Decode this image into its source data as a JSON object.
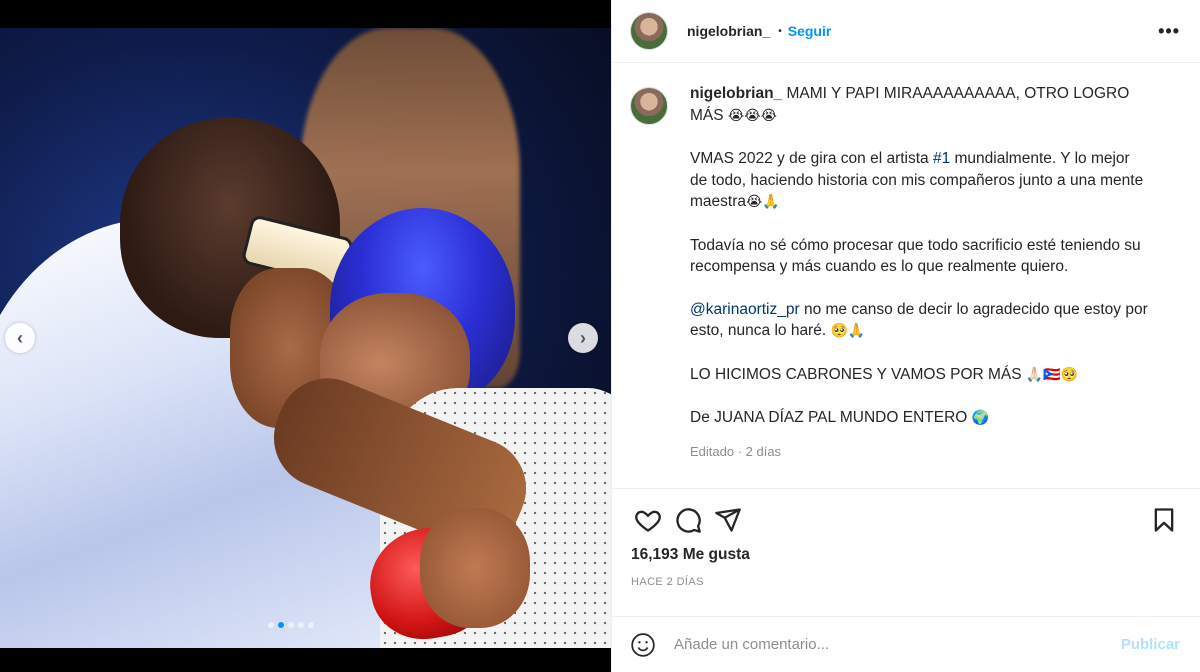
{
  "post": {
    "username": "nigelobrian_",
    "follow_label": "Seguir",
    "separator": "•",
    "more_label": "•••",
    "carousel": {
      "slide_count": 5,
      "active_index": 1
    }
  },
  "caption": {
    "username": "nigelobrian_",
    "line1": "MAMI Y PAPI MIRAAAAAAAAAA, OTRO LOGRO MÁS",
    "line1_emoji": "😭😭😭",
    "p2_a": "VMAS 2022 y de gira con el artista ",
    "p2_hashtag": "#1",
    "p2_b": " mundialmente. Y lo mejor de todo, haciendo historia con mis compañeros junto a una mente maestra",
    "p2_emoji": "😭🙏",
    "p3": "Todavía no sé cómo procesar que todo sacrificio esté teniendo su recompensa y más cuando es lo que realmente quiero.",
    "p4_mention": "@karinaortiz_pr",
    "p4_text": " no me canso de decir lo agradecido que estoy por esto, nunca lo haré. ",
    "p4_emoji": "🥺🙏",
    "p5": "LO HICIMOS CABRONES Y VAMOS POR MÁS ",
    "p5_emoji": "🙏🏻🇵🇷🥺",
    "p6": "De JUANA DÍAZ PAL MUNDO ENTERO ",
    "p6_emoji": "🌍",
    "meta": "Editado · 2 días"
  },
  "actions": {
    "likes": "16,193 Me gusta",
    "timestamp": "HACE 2 DÍAS"
  },
  "comment": {
    "placeholder": "Añade un comentario...",
    "publish_label": "Publicar"
  },
  "colors": {
    "accent": "#0095f6",
    "link": "#00376b",
    "muted": "#8e8e8e",
    "publish_disabled": "#b2dffc",
    "border": "#efefef"
  },
  "icons": {
    "like": "heart-icon",
    "comment": "comment-icon",
    "share": "paper-plane-icon",
    "save": "bookmark-icon",
    "emoji": "smiley-icon",
    "prev": "chevron-left-icon",
    "next": "chevron-right-icon"
  }
}
